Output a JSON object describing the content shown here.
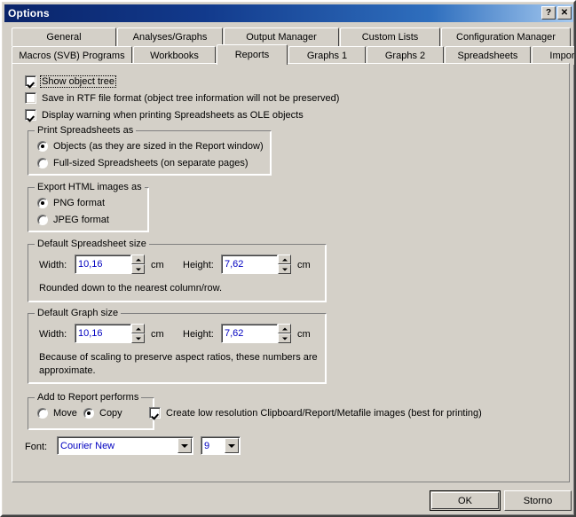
{
  "window": {
    "title": "Options",
    "help_button": "?",
    "close_button": "✕"
  },
  "tabs": {
    "row1": [
      {
        "label": "General",
        "active": false
      },
      {
        "label": "Analyses/Graphs",
        "active": false
      },
      {
        "label": "Output Manager",
        "active": false
      },
      {
        "label": "Custom Lists",
        "active": false
      },
      {
        "label": "Configuration Manager",
        "active": false
      }
    ],
    "row2": [
      {
        "label": "Macros (SVB) Programs",
        "active": false
      },
      {
        "label": "Workbooks",
        "active": false
      },
      {
        "label": "Reports",
        "active": true
      },
      {
        "label": "Graphs 1",
        "active": false
      },
      {
        "label": "Graphs 2",
        "active": false
      },
      {
        "label": "Spreadsheets",
        "active": false
      },
      {
        "label": "Import",
        "active": false
      }
    ]
  },
  "reports": {
    "checkboxes": [
      {
        "label": "Show object tree",
        "checked": true,
        "focused": true
      },
      {
        "label": "Save in RTF file format (object tree information will not be preserved)",
        "checked": false,
        "focused": false
      },
      {
        "label": "Display warning when printing Spreadsheets as OLE objects",
        "checked": true,
        "focused": false
      }
    ],
    "print_spreadsheets_as": {
      "title": "Print Spreadsheets as",
      "options": [
        {
          "label": "Objects (as they are sized in the Report window)",
          "checked": true
        },
        {
          "label": "Full-sized Spreadsheets (on separate pages)",
          "checked": false
        }
      ]
    },
    "export_html_images_as": {
      "title": "Export HTML images as",
      "options": [
        {
          "label": "PNG format",
          "checked": true
        },
        {
          "label": "JPEG format",
          "checked": false
        }
      ]
    },
    "default_spreadsheet_size": {
      "title": "Default Spreadsheet size",
      "width_label": "Width:",
      "width_value": "10,16",
      "width_unit": "cm",
      "height_label": "Height:",
      "height_value": "7,62",
      "height_unit": "cm",
      "note": "Rounded down to the nearest column/row."
    },
    "default_graph_size": {
      "title": "Default Graph size",
      "width_label": "Width:",
      "width_value": "10,16",
      "width_unit": "cm",
      "height_label": "Height:",
      "height_value": "7,62",
      "height_unit": "cm",
      "note_line1": "Because of scaling to preserve aspect ratios, these numbers are",
      "note_line2": "approximate."
    },
    "add_to_report_performs": {
      "title": "Add to Report performs",
      "options": [
        {
          "label": "Move",
          "checked": false
        },
        {
          "label": "Copy",
          "checked": true
        }
      ]
    },
    "low_resolution": {
      "label": "Create low resolution Clipboard/Report/Metafile images (best for printing)",
      "checked": true
    },
    "font": {
      "label": "Font:",
      "family_value": "Courier New",
      "size_value": "9"
    }
  },
  "footer": {
    "ok_label": "OK",
    "cancel_label": "Storno"
  },
  "colors": {
    "face": "#d4d0c8",
    "title_start": "#0a246a",
    "title_end": "#a6caf0",
    "field_text": "#0000c0"
  }
}
